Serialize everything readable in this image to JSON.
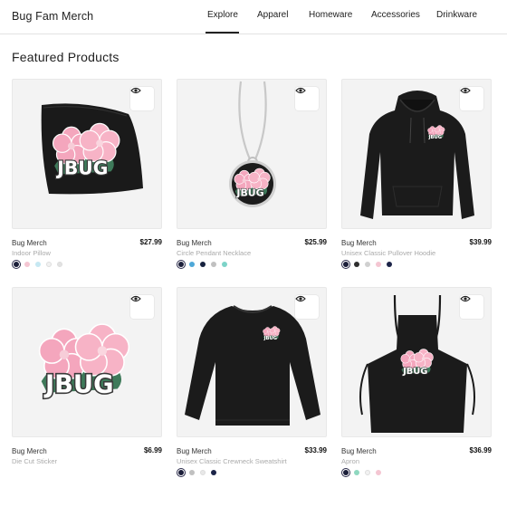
{
  "header": {
    "brand": "Bug Fam Merch",
    "nav": [
      "Explore",
      "Apparel",
      "Homeware",
      "Accessories",
      "Drinkware"
    ],
    "active_tab": "Explore"
  },
  "section": {
    "title": "Featured Products"
  },
  "products": [
    {
      "brand": "Bug Merch",
      "name": "Indoor Pillow",
      "price": "$27.99",
      "image": "pillow",
      "swatches": [
        "#1c1f3a",
        "#f4c6d2",
        "#c6e8f2",
        "#f2f2f2",
        "#e2e2e2"
      ]
    },
    {
      "brand": "Bug Merch",
      "name": "Circle Pendant Necklace",
      "price": "$25.99",
      "image": "necklace",
      "swatches": [
        "#1c1f3a",
        "#4ea8d8",
        "#16213e",
        "#c0c0c0",
        "#7dd3c8"
      ]
    },
    {
      "brand": "Bug Merch",
      "name": "Unisex Classic Pullover Hoodie",
      "price": "$39.99",
      "image": "hoodie",
      "swatches": [
        "#1c1f3a",
        "#2e2e2e",
        "#d0d0d0",
        "#f4c6d2",
        "#1c2448"
      ]
    },
    {
      "brand": "Bug Merch",
      "name": "Die Cut Sticker",
      "price": "$6.99",
      "image": "sticker",
      "swatches": []
    },
    {
      "brand": "Bug Merch",
      "name": "Unisex Classic Crewneck Sweatshirt",
      "price": "$33.99",
      "image": "sweatshirt",
      "swatches": [
        "#1c1f3a",
        "#c0c0c0",
        "#e8e8e8",
        "#1c2448"
      ]
    },
    {
      "brand": "Bug Merch",
      "name": "Apron",
      "price": "$36.99",
      "image": "apron",
      "swatches": [
        "#1c1f3a",
        "#8fd8c0",
        "#f2f2f2",
        "#f4c6d2"
      ]
    }
  ],
  "logo_text": "JBUG",
  "icons": {
    "quick_view": "eye-icon"
  },
  "colors": {
    "accent": "#222222",
    "blossom": "#f4a6bd",
    "leaf": "#3e7a5a"
  }
}
